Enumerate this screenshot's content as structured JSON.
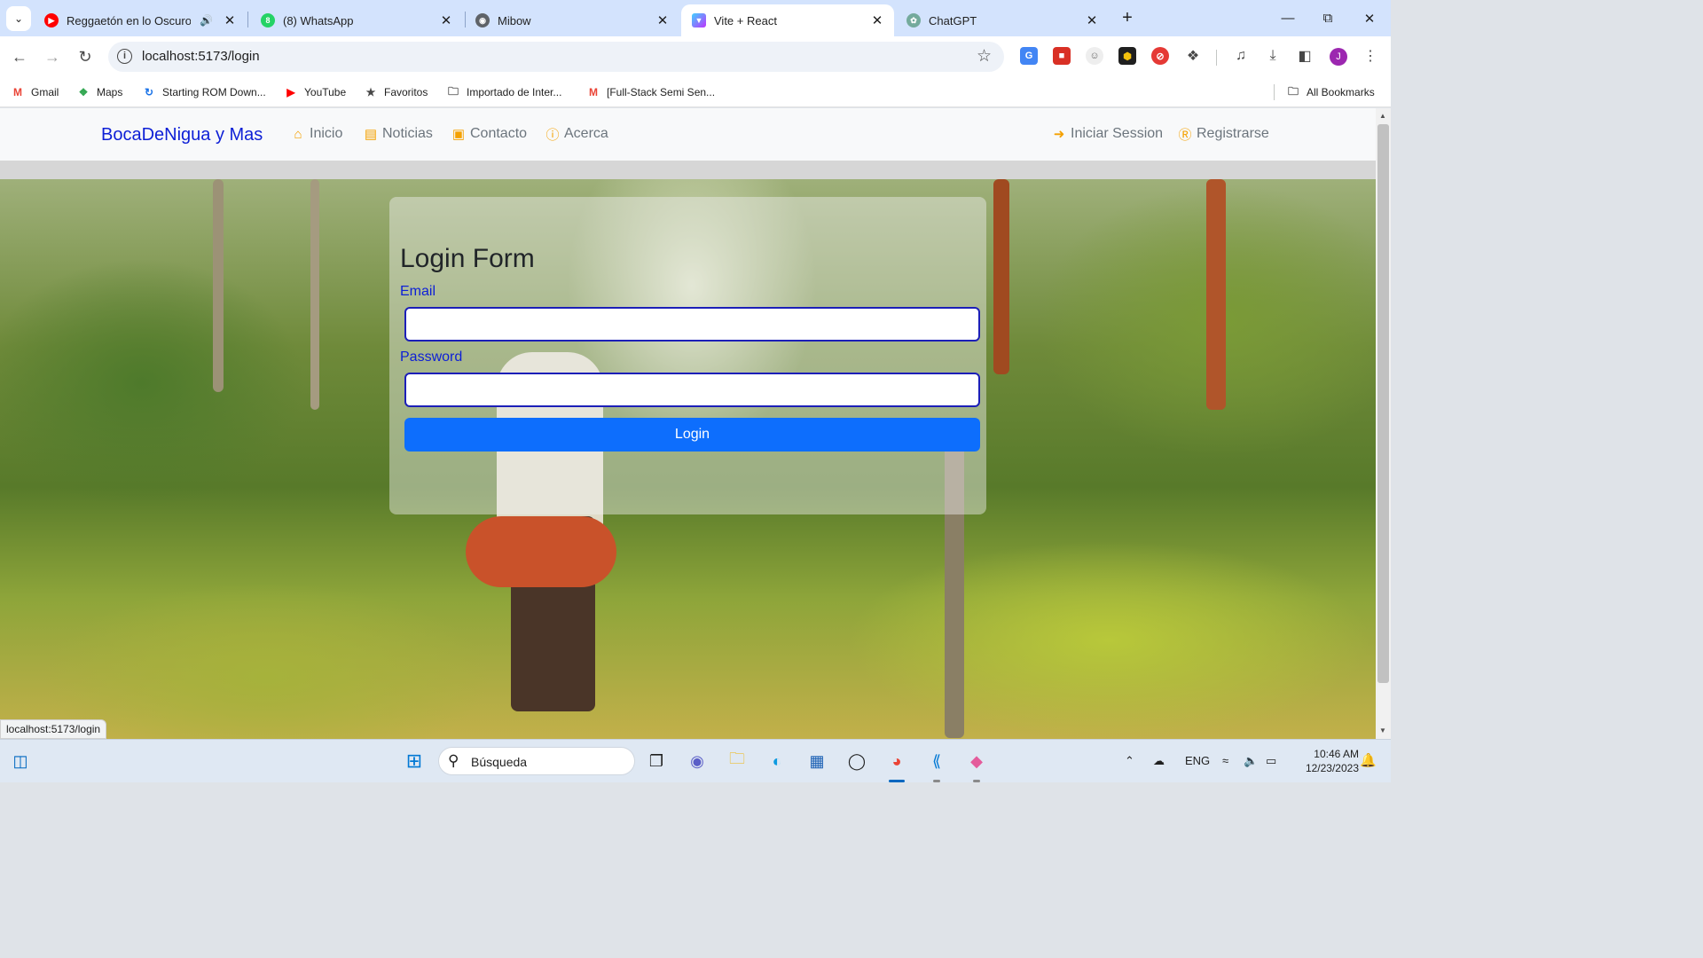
{
  "browser": {
    "tabs": [
      {
        "title": "Reggaetón en lo Oscuro (O",
        "favicon": "youtube-icon",
        "active": false,
        "audio": true
      },
      {
        "title": "(8) WhatsApp",
        "favicon": "whatsapp-icon",
        "active": false,
        "badge": "8"
      },
      {
        "title": "Mibow",
        "favicon": "globe-icon",
        "active": false
      },
      {
        "title": "Vite + React",
        "favicon": "vite-icon",
        "active": true
      },
      {
        "title": "ChatGPT",
        "favicon": "chatgpt-icon",
        "active": false
      }
    ],
    "url": "localhost:5173/login",
    "profile_initial": "J",
    "bookmarks": [
      {
        "label": "Gmail",
        "icon": "gmail-icon"
      },
      {
        "label": "Maps",
        "icon": "maps-icon"
      },
      {
        "label": "Starting ROM Down...",
        "icon": "refresh-logo-icon"
      },
      {
        "label": "YouTube",
        "icon": "youtube-icon"
      },
      {
        "label": "Favoritos",
        "icon": "star-icon"
      },
      {
        "label": "Importado de Inter...",
        "icon": "folder-icon"
      },
      {
        "label": "[Full-Stack Semi Sen...",
        "icon": "gmail-icon"
      }
    ],
    "all_bookmarks": "All Bookmarks",
    "status_url": "localhost:5173/login"
  },
  "site": {
    "brand": "BocaDeNigua y Mas",
    "nav": {
      "inicio": "Inicio",
      "noticias": "Noticias",
      "contacto": "Contacto",
      "acerca": "Acerca",
      "login": "Iniciar Session",
      "register": "Registrarse"
    },
    "login": {
      "title": "Login Form",
      "email_label": "Email",
      "email_value": "",
      "password_label": "Password",
      "password_value": "",
      "button": "Login"
    }
  },
  "taskbar": {
    "search_placeholder": "Búsqueda",
    "language": "ENG",
    "time": "10:46 AM",
    "date": "12/23/2023"
  },
  "colors": {
    "brand": "#0d1fd6",
    "nav_icon": "#f4a100",
    "login_button": "#0d6efd",
    "input_border": "#1c1fb8"
  }
}
